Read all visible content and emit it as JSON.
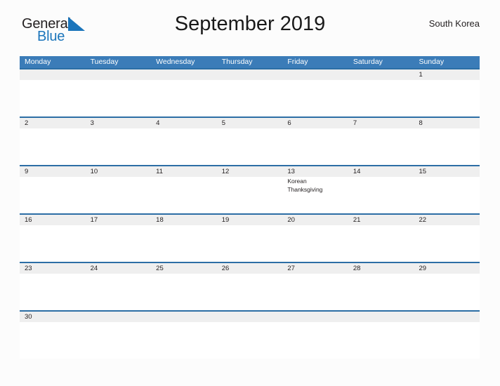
{
  "brand": {
    "name_part1": "General",
    "name_part2": "Blue",
    "triangle_color": "#1b75bb",
    "part1_color": "#231f20",
    "part2_color": "#1b75bb"
  },
  "header": {
    "title": "September 2019",
    "region": "South Korea"
  },
  "theme": {
    "header_blue": "#3b7cb8",
    "divider_blue": "#2c6ea5",
    "date_band_gray": "#efefef",
    "page_background": "#fcfcfc",
    "text_color": "#231f20"
  },
  "calendar": {
    "month": "September",
    "year": "2019",
    "weekday_headers": [
      "Monday",
      "Tuesday",
      "Wednesday",
      "Thursday",
      "Friday",
      "Saturday",
      "Sunday"
    ],
    "weeks": [
      [
        {
          "date": "",
          "events": []
        },
        {
          "date": "",
          "events": []
        },
        {
          "date": "",
          "events": []
        },
        {
          "date": "",
          "events": []
        },
        {
          "date": "",
          "events": []
        },
        {
          "date": "",
          "events": []
        },
        {
          "date": "1",
          "events": []
        }
      ],
      [
        {
          "date": "2",
          "events": []
        },
        {
          "date": "3",
          "events": []
        },
        {
          "date": "4",
          "events": []
        },
        {
          "date": "5",
          "events": []
        },
        {
          "date": "6",
          "events": []
        },
        {
          "date": "7",
          "events": []
        },
        {
          "date": "8",
          "events": []
        }
      ],
      [
        {
          "date": "9",
          "events": []
        },
        {
          "date": "10",
          "events": []
        },
        {
          "date": "11",
          "events": []
        },
        {
          "date": "12",
          "events": []
        },
        {
          "date": "13",
          "events": [
            "Korean Thanksgiving"
          ]
        },
        {
          "date": "14",
          "events": []
        },
        {
          "date": "15",
          "events": []
        }
      ],
      [
        {
          "date": "16",
          "events": []
        },
        {
          "date": "17",
          "events": []
        },
        {
          "date": "18",
          "events": []
        },
        {
          "date": "19",
          "events": []
        },
        {
          "date": "20",
          "events": []
        },
        {
          "date": "21",
          "events": []
        },
        {
          "date": "22",
          "events": []
        }
      ],
      [
        {
          "date": "23",
          "events": []
        },
        {
          "date": "24",
          "events": []
        },
        {
          "date": "25",
          "events": []
        },
        {
          "date": "26",
          "events": []
        },
        {
          "date": "27",
          "events": []
        },
        {
          "date": "28",
          "events": []
        },
        {
          "date": "29",
          "events": []
        }
      ],
      [
        {
          "date": "30",
          "events": []
        },
        {
          "date": "",
          "events": []
        },
        {
          "date": "",
          "events": []
        },
        {
          "date": "",
          "events": []
        },
        {
          "date": "",
          "events": []
        },
        {
          "date": "",
          "events": []
        },
        {
          "date": "",
          "events": []
        }
      ]
    ]
  }
}
